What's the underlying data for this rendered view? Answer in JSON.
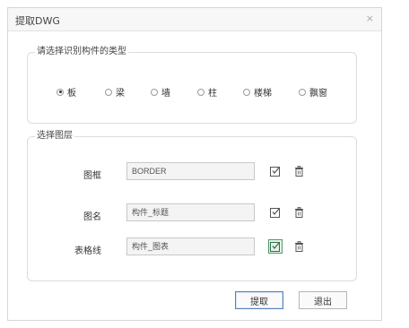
{
  "window": {
    "title": "提取DWG",
    "close": "×"
  },
  "type_group": {
    "legend": "请选择识别构件的类型",
    "options": [
      {
        "label": "板",
        "checked": true
      },
      {
        "label": "梁",
        "checked": false
      },
      {
        "label": "墙",
        "checked": false
      },
      {
        "label": "柱",
        "checked": false
      },
      {
        "label": "楼梯",
        "checked": false
      },
      {
        "label": "飘窗",
        "checked": false
      }
    ]
  },
  "layer_group": {
    "legend": "选择图层",
    "rows": [
      {
        "label": "图框",
        "value": "BORDER"
      },
      {
        "label": "图名",
        "value": "构件_标题"
      },
      {
        "label": "表格线",
        "value": "构件_图表"
      }
    ]
  },
  "buttons": {
    "extract": "提取",
    "exit": "退出"
  },
  "colors": {
    "active_pick": "#4f9a6a",
    "primary_border": "#5a7fb8"
  },
  "icons": {
    "pick": "select-from-drawing-icon",
    "delete": "trash-icon"
  }
}
